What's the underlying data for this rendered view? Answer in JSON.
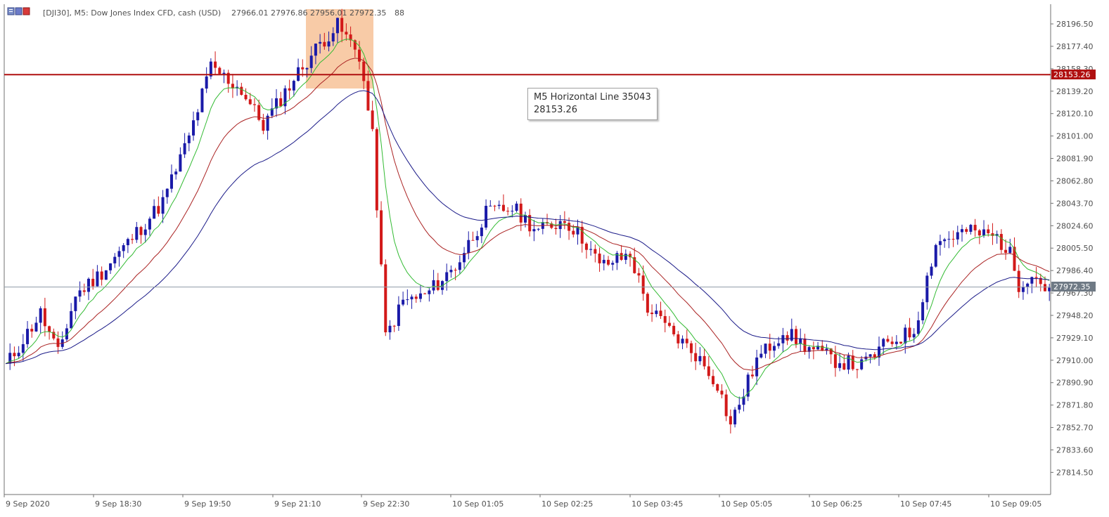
{
  "header": {
    "symbol": "[DJI30], M5:  Dow Jones Index CFD, cash (USD)",
    "values": "27966.01 27976.86 27956.01 27972.35",
    "extra": "88"
  },
  "tooltip": {
    "title": "M5 Horizontal Line 35043",
    "value": "28153.26"
  },
  "colors": {
    "bull": "#1a1aa8",
    "bear": "#d21919",
    "ma_fast": "#33bb33",
    "ma_mid": "#aa2222",
    "ma_slow": "#1a1a88",
    "hline": "#b01010",
    "price_line": "#8e9aa6",
    "highlight": "#f5b98a"
  },
  "chart_data": {
    "type": "candlestick",
    "timeframe": "M5",
    "ylim": [
      27800,
      28210
    ],
    "y_ticks": [
      "28196.50",
      "28177.40",
      "28158.30",
      "28139.20",
      "28120.10",
      "28101.00",
      "28081.90",
      "28062.80",
      "28043.70",
      "28024.60",
      "28005.50",
      "27986.40",
      "27967.30",
      "27948.20",
      "27929.10",
      "27910.00",
      "27890.90",
      "27871.80",
      "27852.70",
      "27833.60",
      "27814.50"
    ],
    "x_ticks": [
      "9 Sep 2020",
      "9 Sep 18:30",
      "9 Sep 19:50",
      "9 Sep 21:10",
      "9 Sep 22:30",
      "10 Sep 01:05",
      "10 Sep 02:25",
      "10 Sep 03:45",
      "10 Sep 05:05",
      "10 Sep 06:25",
      "10 Sep 07:45",
      "10 Sep 09:05"
    ],
    "horizontal_line": {
      "name": "M5 Horizontal Line 35043",
      "value": 28153.26,
      "label": "28153.26"
    },
    "current_price": {
      "value": 27972.35,
      "label": "27972.35"
    },
    "moving_averages": [
      "fast (green)",
      "medium (red)",
      "slow (blue)"
    ],
    "close_path": [
      [
        0,
        27905
      ],
      [
        8,
        27950
      ],
      [
        12,
        27915
      ],
      [
        16,
        27965
      ],
      [
        22,
        27985
      ],
      [
        28,
        28010
      ],
      [
        36,
        28045
      ],
      [
        42,
        28100
      ],
      [
        47,
        28160
      ],
      [
        54,
        28140
      ],
      [
        59,
        28110
      ],
      [
        66,
        28150
      ],
      [
        72,
        28180
      ],
      [
        76,
        28195
      ],
      [
        81,
        28170
      ],
      [
        84,
        28100
      ],
      [
        87,
        27930
      ],
      [
        91,
        27960
      ],
      [
        96,
        27965
      ],
      [
        103,
        27990
      ],
      [
        110,
        28035
      ],
      [
        116,
        28040
      ],
      [
        122,
        28020
      ],
      [
        128,
        28030
      ],
      [
        133,
        28010
      ],
      [
        136,
        27990
      ],
      [
        143,
        28000
      ],
      [
        147,
        27955
      ],
      [
        152,
        27935
      ],
      [
        158,
        27915
      ],
      [
        163,
        27890
      ],
      [
        166,
        27855
      ],
      [
        172,
        27910
      ],
      [
        178,
        27935
      ],
      [
        184,
        27920
      ],
      [
        190,
        27910
      ],
      [
        196,
        27905
      ],
      [
        202,
        27925
      ],
      [
        208,
        27935
      ],
      [
        213,
        28010
      ],
      [
        220,
        28020
      ],
      [
        227,
        28015
      ],
      [
        230,
        28000
      ],
      [
        232,
        27975
      ],
      [
        235,
        27985
      ],
      [
        238,
        27972
      ]
    ]
  }
}
